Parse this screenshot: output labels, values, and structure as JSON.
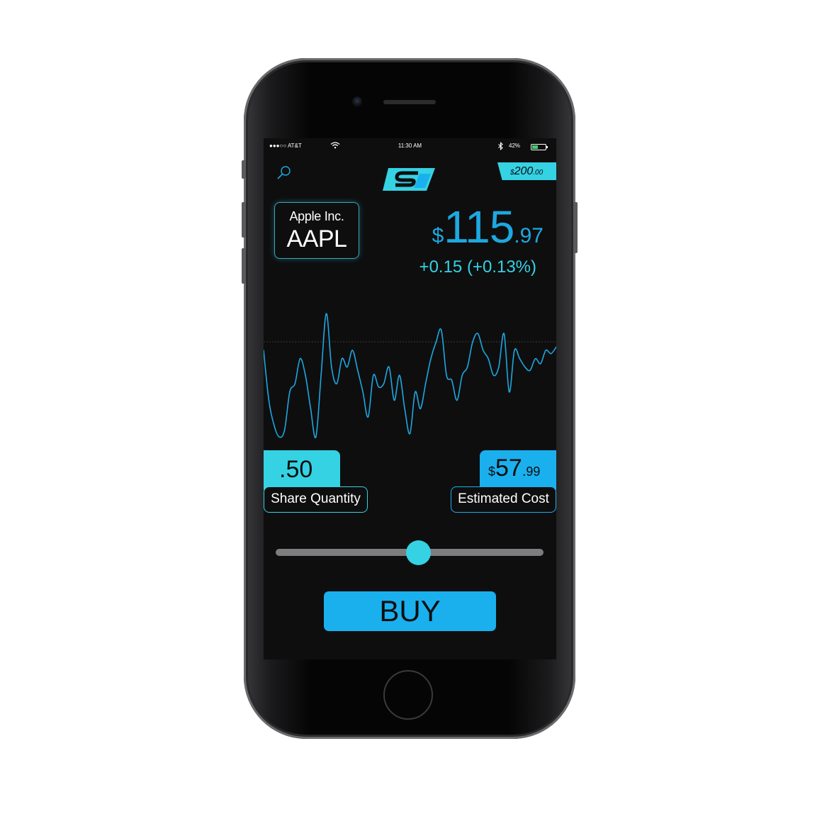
{
  "status_bar": {
    "carrier": "●●●○○ AT&T",
    "time": "11:30 AM",
    "battery_percent": "42%",
    "battery_level": 0.42,
    "icons": [
      "wifi-icon",
      "bluetooth-icon",
      "battery-icon"
    ]
  },
  "header": {
    "search_icon": "search-icon",
    "logo_icon": "app-logo-s-icon",
    "balance": {
      "currency": "$",
      "main": "200",
      "cents": ".00"
    }
  },
  "stock": {
    "company": "Apple Inc.",
    "symbol": "AAPL",
    "price": {
      "currency": "$",
      "main": "115",
      "dot": ".",
      "cents": "97"
    },
    "change": "+0.15 (+0.13%)"
  },
  "chart_data": {
    "type": "line",
    "title": "",
    "xlabel": "",
    "ylabel": "",
    "baseline": "dashed",
    "ylim": [
      0,
      100
    ],
    "series": [
      {
        "color": "#1da8e0",
        "values": [
          60,
          30,
          15,
          8,
          12,
          35,
          40,
          55,
          45,
          25,
          8,
          45,
          82,
          50,
          40,
          55,
          50,
          60,
          48,
          35,
          20,
          45,
          38,
          40,
          50,
          30,
          45,
          25,
          10,
          35,
          25,
          40,
          55,
          65,
          72,
          45,
          42,
          30,
          45,
          50,
          65,
          70,
          60,
          55,
          45,
          50,
          70,
          35,
          60,
          55,
          50,
          48,
          55,
          52,
          60,
          58,
          62
        ]
      }
    ]
  },
  "trade": {
    "share_quantity_value": ".50",
    "share_quantity_label": "Share Quantity",
    "estimated_cost": {
      "currency": "$",
      "main": "57",
      "dot": ".",
      "cents": "99"
    },
    "estimated_cost_label": "Estimated Cost",
    "slider_fraction": 0.5
  },
  "actions": {
    "buy_label": "BUY"
  },
  "colors": {
    "accent": "#35d2e3",
    "primary": "#1ab0ee",
    "background": "#0e0e0f"
  }
}
